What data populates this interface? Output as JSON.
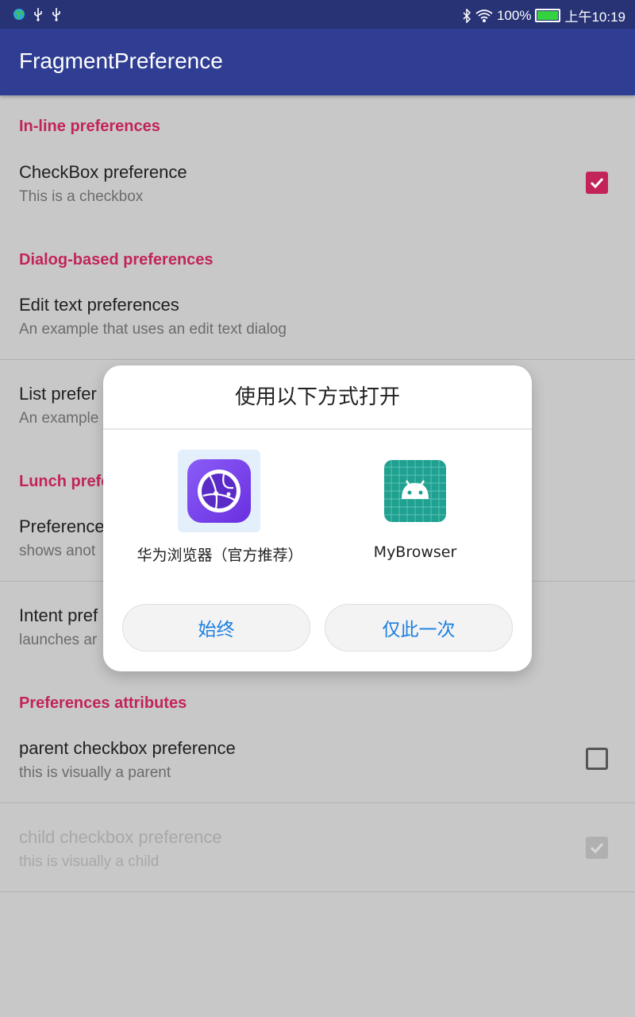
{
  "status_bar": {
    "battery": "100%",
    "time": "上午10:19"
  },
  "app_bar": {
    "title": "FragmentPreference"
  },
  "preferences": {
    "inline_category": "In-line preferences",
    "checkbox_title": "CheckBox preference",
    "checkbox_summary": "This is a checkbox",
    "checkbox_checked": true,
    "dialog_category": "Dialog-based preferences",
    "edit_text_title": "Edit text preferences",
    "edit_text_summary": "An example that uses an edit text dialog",
    "list_title_partial": "List prefer",
    "list_summary_partial": "An example",
    "launch_category_partial": "Lunch prefe",
    "preference_title_partial": "Preference",
    "preference_summary_partial": "shows anot",
    "intent_title_partial": "Intent pref",
    "intent_summary_partial": "launches ar",
    "attributes_category": "Preferences attributes",
    "parent_title": "parent checkbox preference",
    "parent_summary": "this is visually a parent",
    "parent_checked": false,
    "child_title": "child checkbox preference",
    "child_summary": "this is visually a child",
    "child_checked": true
  },
  "dialog": {
    "title": "使用以下方式打开",
    "apps": [
      {
        "label": "华为浏览器（官方推荐）",
        "icon": "huawei-browser-icon"
      },
      {
        "label": "MyBrowser",
        "icon": "android-icon"
      }
    ],
    "always_button": "始终",
    "once_button": "仅此一次"
  },
  "colors": {
    "accent": "#c2245a",
    "primary": "#2f3e93",
    "primary_dark": "#283375",
    "dialog_button_text": "#1b7fe0",
    "scrim": "#c8c8c8"
  }
}
